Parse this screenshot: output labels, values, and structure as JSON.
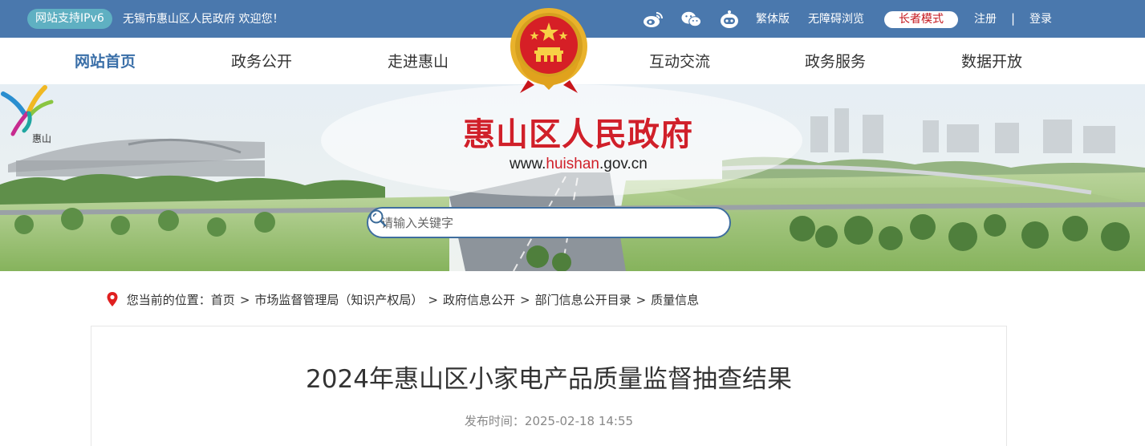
{
  "topbar": {
    "ipv6_badge": "网站支持IPv6",
    "welcome": "无锡市惠山区人民政府 欢迎您！",
    "icons": [
      "weibo-icon",
      "wechat-icon",
      "robot-icon"
    ],
    "traditional": "繁体版",
    "accessible": "无障碍浏览",
    "elder_mode": "长者模式",
    "register": "注册",
    "separator": "|",
    "login": "登录",
    "colors": {
      "bar": "#4a78ad",
      "ipv6": "#5fb0c2",
      "elder_text": "#c4161c"
    }
  },
  "nav": {
    "items": [
      {
        "label": "网站首页",
        "active": true
      },
      {
        "label": "政务公开",
        "active": false
      },
      {
        "label": "走进惠山",
        "active": false
      },
      {
        "label": "互动交流",
        "active": false
      },
      {
        "label": "政务服务",
        "active": false
      },
      {
        "label": "数据开放",
        "active": false
      }
    ]
  },
  "banner": {
    "site_name": "惠山区人民政府",
    "url_prefix": "www.",
    "url_highlight": "huishan",
    "url_suffix": ".gov.cn",
    "logo_text": "惠山",
    "search_placeholder": "请输入关键字"
  },
  "breadcrumb": {
    "prefix": "您当前的位置：",
    "items": [
      "首页",
      "市场监督管理局（知识产权局）",
      "政府信息公开",
      "部门信息公开目录",
      "质量信息"
    ],
    "separator": ">"
  },
  "article": {
    "title": "2024年惠山区小家电产品质量监督抽查结果",
    "published": "发布时间：2025-02-18 14:55"
  }
}
